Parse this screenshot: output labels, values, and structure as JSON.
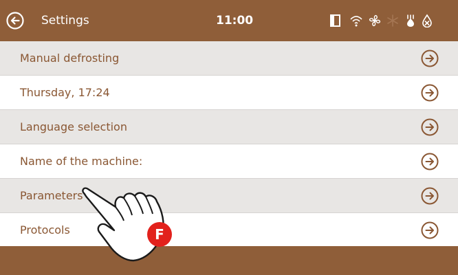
{
  "header": {
    "title": "Settings",
    "time": "11:00",
    "status_icons": [
      "door-icon",
      "wifi-icon",
      "fan-icon",
      "snowflake-icon",
      "defrost-icon",
      "no-water-icon"
    ]
  },
  "rows": [
    {
      "label": "Manual defrosting"
    },
    {
      "label": "Thursday, 17:24"
    },
    {
      "label": "Language selection"
    },
    {
      "label": "Name of the machine:"
    },
    {
      "label": "Parameters"
    },
    {
      "label": "Protocols"
    }
  ],
  "callout": {
    "badge": "F"
  },
  "colors": {
    "bar": "#8f5e39",
    "row_alt": "#e8e6e4",
    "text": "#8a5733",
    "badge": "#e2211c"
  }
}
